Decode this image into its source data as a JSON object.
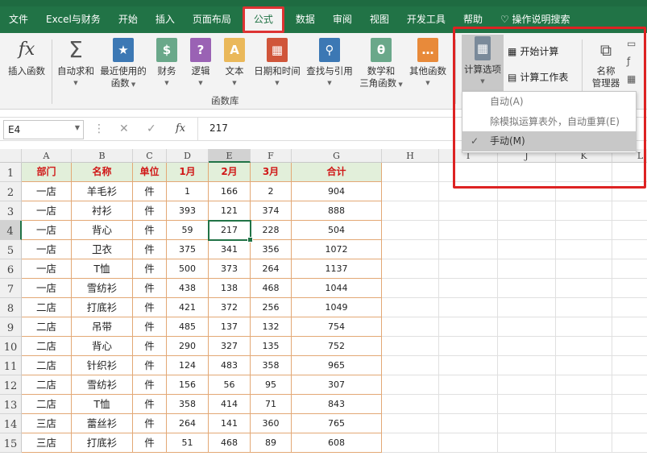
{
  "tabs": [
    "文件",
    "Excel与财务",
    "开始",
    "插入",
    "页面布局",
    "公式",
    "数据",
    "审阅",
    "视图",
    "开发工具",
    "帮助"
  ],
  "tell_me": "操作说明搜索",
  "ribbon": {
    "insert_function": "插入函数",
    "autosum": "自动求和",
    "recent": "最近使用的",
    "recent2": "函数",
    "financial": "财务",
    "logical": "逻辑",
    "text": "文本",
    "datetime": "日期和时间",
    "lookup": "查找与引用",
    "math": "数学和",
    "math2": "三角函数",
    "other": "其他函数",
    "group_label": "函数库",
    "calc_options": "计算选项",
    "calc_now": "开始计算",
    "calc_sheet": "计算工作表",
    "name_manager": "名称",
    "name_manager2": "管理器"
  },
  "dropdown": [
    {
      "label": "自动(A)",
      "checked": false
    },
    {
      "label": "除模拟运算表外，自动重算(E)",
      "checked": false
    },
    {
      "label": "手动(M)",
      "checked": true
    }
  ],
  "formula_bar": {
    "name_box": "E4",
    "fx": "fx",
    "value": "217"
  },
  "columns": [
    "A",
    "B",
    "C",
    "D",
    "E",
    "F",
    "G",
    "H",
    "I",
    "J",
    "K",
    "L"
  ],
  "headers": [
    "部门",
    "名称",
    "单位",
    "1月",
    "2月",
    "3月",
    "合计"
  ],
  "rows": [
    [
      "一店",
      "羊毛衫",
      "件",
      "1",
      "166",
      "2",
      "904"
    ],
    [
      "一店",
      "衬衫",
      "件",
      "393",
      "121",
      "374",
      "888"
    ],
    [
      "一店",
      "背心",
      "件",
      "59",
      "217",
      "228",
      "504"
    ],
    [
      "一店",
      "卫衣",
      "件",
      "375",
      "341",
      "356",
      "1072"
    ],
    [
      "一店",
      "T恤",
      "件",
      "500",
      "373",
      "264",
      "1137"
    ],
    [
      "一店",
      "雪纺衫",
      "件",
      "438",
      "138",
      "468",
      "1044"
    ],
    [
      "二店",
      "打底衫",
      "件",
      "421",
      "372",
      "256",
      "1049"
    ],
    [
      "二店",
      "吊带",
      "件",
      "485",
      "137",
      "132",
      "754"
    ],
    [
      "二店",
      "背心",
      "件",
      "290",
      "327",
      "135",
      "752"
    ],
    [
      "二店",
      "针织衫",
      "件",
      "124",
      "483",
      "358",
      "965"
    ],
    [
      "二店",
      "雪纺衫",
      "件",
      "156",
      "56",
      "95",
      "307"
    ],
    [
      "二店",
      "T恤",
      "件",
      "358",
      "414",
      "71",
      "843"
    ],
    [
      "三店",
      "蕾丝衫",
      "件",
      "264",
      "141",
      "360",
      "765"
    ],
    [
      "三店",
      "打底衫",
      "件",
      "51",
      "468",
      "89",
      "608"
    ]
  ]
}
